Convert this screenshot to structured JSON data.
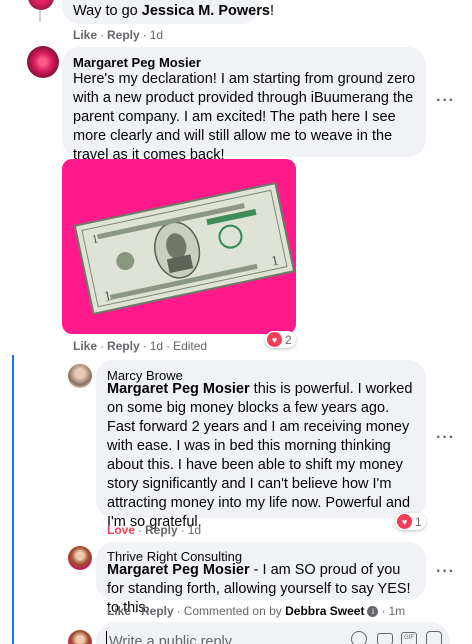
{
  "top_comment": {
    "text_prefix": "Way to go ",
    "text_name": "Jessica M. Powers",
    "text_suffix": "!",
    "like": "Like",
    "reply": "Reply",
    "time": "1d"
  },
  "main_comment": {
    "author": "Margaret Peg Mosier",
    "text": "Here's my declaration! I am starting from ground zero with a new product provided through iBuumerang the parent company. I am excited! The path here I see more clearly and will still allow me to weave in the travel as it comes back!",
    "image_alt": "dollar bill on pink background",
    "reaction_count": "2",
    "like": "Like",
    "reply": "Reply",
    "time": "1d",
    "edited": "Edited"
  },
  "reply1": {
    "author": "Marcy Browe",
    "tag": "Margaret Peg Mosier",
    "text": " this is powerful. I worked on some big money blocks a few years ago. Fast forward 2 years and I am receiving money with ease. I was in bed this morning thinking about this. I have been able to shift my money story significantly and I can't believe how I'm attracting money into my life now. Powerful and I'm so grateful.",
    "reaction_count": "1",
    "love": "Love",
    "reply": "Reply",
    "time": "1d"
  },
  "reply2": {
    "author": "Thrive Right Consulting",
    "tag": "Margaret Peg Mosier",
    "text": " - I am SO proud of you for standing forth, allowing yourself to say YES! to this.",
    "like": "Like",
    "reply": "Reply",
    "commented_on_by": "Commented on by",
    "commenter": "Debbra Sweet",
    "time": "1m"
  },
  "composer": {
    "placeholder": "Write a public reply..."
  },
  "colors": {
    "accent_blue": "#1877f2",
    "love_red": "#f33e58",
    "bubble_bg": "#f0f2f5",
    "pink_bg": "#ff1493"
  }
}
